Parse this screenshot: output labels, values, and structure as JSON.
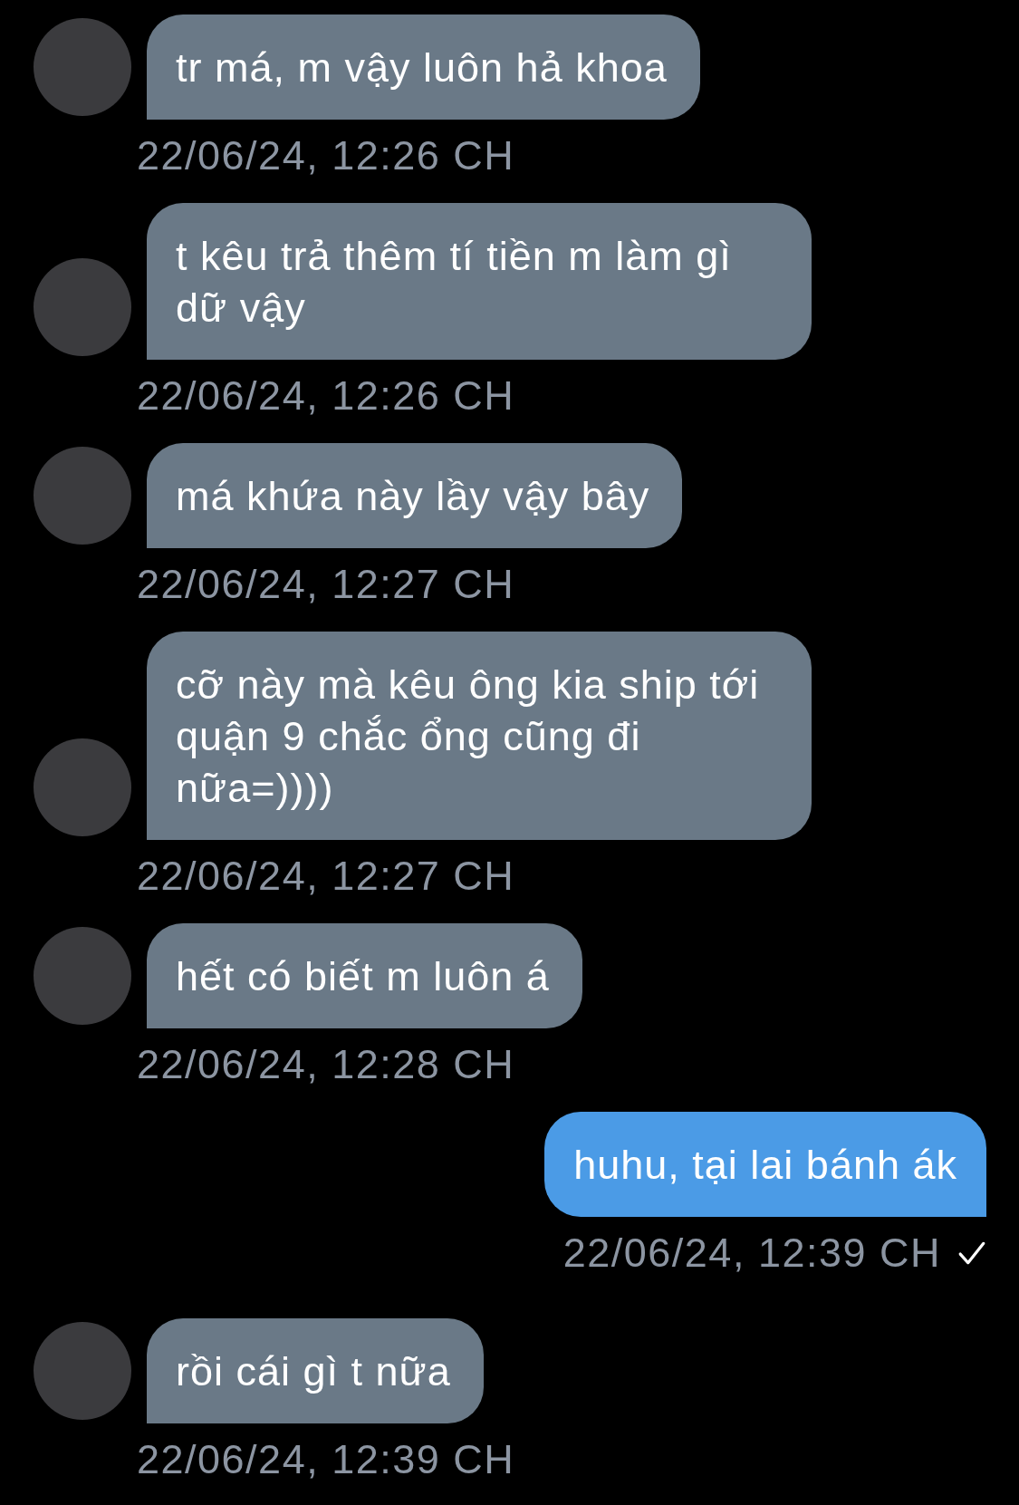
{
  "messages": [
    {
      "kind": "received",
      "lines": [
        "tr má, m vậy luôn hả khoa"
      ],
      "time": "22/06/24, 12:26 CH"
    },
    {
      "kind": "received",
      "lines": [
        "t kêu trả thêm tí tiền m làm gì",
        "dữ vậy"
      ],
      "time": "22/06/24, 12:26 CH"
    },
    {
      "kind": "received",
      "lines": [
        "má khứa này lầy vậy bây"
      ],
      "time": "22/06/24, 12:27 CH"
    },
    {
      "kind": "received",
      "lines": [
        "cỡ này mà kêu ông kia ship tới",
        "quận 9 chắc ổng cũng đi",
        "nữa=))))"
      ],
      "time": "22/06/24, 12:27 CH"
    },
    {
      "kind": "received",
      "lines": [
        "hết có biết m luôn á"
      ],
      "time": "22/06/24, 12:28 CH"
    },
    {
      "kind": "sent",
      "lines": [
        "huhu, tại lai bánh ák"
      ],
      "time": "22/06/24, 12:39 CH",
      "read": true
    },
    {
      "kind": "received",
      "lines": [
        "rồi cái gì t nữa"
      ],
      "time": "22/06/24, 12:39 CH"
    }
  ]
}
